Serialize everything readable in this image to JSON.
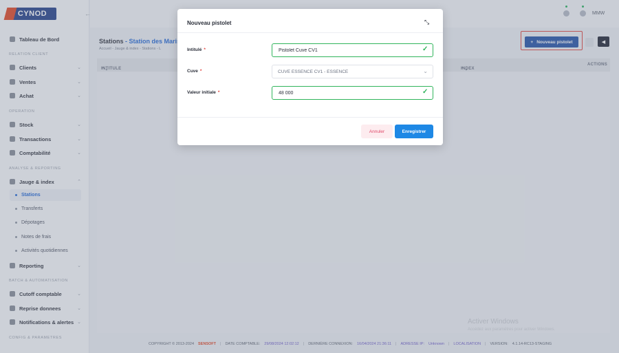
{
  "app": {
    "logo_text": "CYNOD",
    "collapse_icon": "arrow-left-icon"
  },
  "sidebar": {
    "items": [
      {
        "label": "Tableau de Bord"
      },
      {
        "section": "RELATION CLIENT"
      },
      {
        "label": "Clients"
      },
      {
        "label": "Ventes"
      },
      {
        "label": "Achat"
      },
      {
        "section": "OPERATION"
      },
      {
        "label": "Stock"
      },
      {
        "label": "Transactions"
      },
      {
        "label": "Comptabilité"
      },
      {
        "section": "ANALYSE & REPORTING"
      },
      {
        "label": "Jauge & index"
      },
      {
        "sub": "Stations"
      },
      {
        "sub": "Transferts"
      },
      {
        "sub": "Dépotages"
      },
      {
        "sub": "Notes de frais"
      },
      {
        "sub": "Activités quotidiennes"
      },
      {
        "label": "Reporting"
      },
      {
        "section": "BATCH & AUTOMATISATION"
      },
      {
        "label": "Cutoff comptable"
      },
      {
        "label": "Reprise donnees"
      },
      {
        "label": "Notifications & alertes"
      },
      {
        "section": "CONFIG & PARAMETRES"
      }
    ]
  },
  "header": {
    "user": "MMW"
  },
  "page": {
    "title": "Stations",
    "title_separator": " - ",
    "subtitle": "Station des Marist",
    "breadcrumb": "Accueil  -  Jauge & index  -  Stations  -  L"
  },
  "toolbar": {
    "new_button": "Nouveau pistolet",
    "new_icon": "+",
    "back_icon": "◀"
  },
  "table": {
    "columns": [
      "INTITULE",
      "INDEX",
      "ACTIONS"
    ],
    "sort_icon": "⌃⌄"
  },
  "modal": {
    "title": "Nouveau pistolet",
    "close_icon": "expand-icon",
    "fields": {
      "intitule": {
        "label": "Intitulé",
        "value": "Pistolet Cuve CV1"
      },
      "cuve": {
        "label": "Cuve",
        "value": "CUVE ESSENCE CV1 - ESSENCE"
      },
      "valeur": {
        "label": "Valeur initiale",
        "value": "48 000"
      }
    },
    "required_mark": "*",
    "cancel": "Annuler",
    "save": "Enregistrer"
  },
  "watermark": {
    "line1": "Activer Windows",
    "line2": "Accédez aux paramètres pour activer Windows."
  },
  "footer": {
    "copyright": "COPYRIGHT © 2013-2024",
    "brand": "SENSOFT",
    "date_label": "DATE COMPTABLE:",
    "date_value": "29/08/2024 12:02:12",
    "login_label": "DERNIÈRE CONNEXION:",
    "login_value": "16/04/2024 21:36:11",
    "ip_label": "ADRESSE IP:",
    "ip_value": "Unknown",
    "loc_label": "LOCALISATION",
    "version_label": "VERSION:",
    "version_value": "4.1.14-RC13-STAGING"
  },
  "colors": {
    "primary": "#1f4fa6",
    "accent_blue": "#1e88e5",
    "success": "#2fb45a",
    "danger": "#e0403a",
    "brand_orange": "#e2421f"
  }
}
